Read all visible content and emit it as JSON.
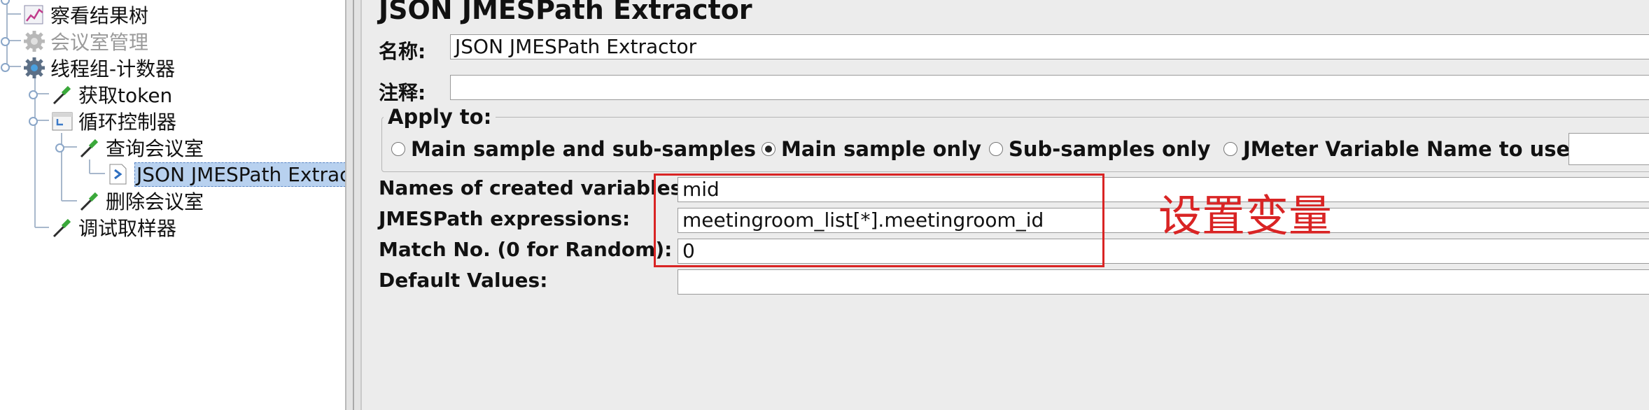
{
  "tree": {
    "items": [
      {
        "label": "察看结果树",
        "icon": "graph-icon"
      },
      {
        "label": "会议室管理",
        "icon": "gear-icon"
      },
      {
        "label": "线程组-计数器",
        "icon": "gear-icon"
      },
      {
        "label": "获取token",
        "icon": "pipette-icon"
      },
      {
        "label": "循环控制器",
        "icon": "loop-controller-icon"
      },
      {
        "label": "查询会议室",
        "icon": "pipette-icon"
      },
      {
        "label": "JSON JMESPath Extrac",
        "icon": "extractor-icon"
      },
      {
        "label": "删除会议室",
        "icon": "pipette-icon"
      },
      {
        "label": "调试取样器",
        "icon": "pipette-icon"
      }
    ]
  },
  "main": {
    "title": "JSON JMESPath Extractor",
    "name_label": "名称:",
    "name_value": "JSON JMESPath Extractor",
    "comment_label": "注释:",
    "comment_value": "",
    "apply_to": {
      "legend": "Apply to:",
      "options": [
        {
          "label": "Main sample and sub-samples",
          "selected": false
        },
        {
          "label": "Main sample only",
          "selected": true
        },
        {
          "label": "Sub-samples only",
          "selected": false
        },
        {
          "label": "JMeter Variable Name to use",
          "selected": false
        }
      ],
      "variable_name_value": ""
    },
    "fields": [
      {
        "label": "Names of created variables:",
        "value": "mid"
      },
      {
        "label": "JMESPath expressions:",
        "value": "meetingroom_list[*].meetingroom_id"
      },
      {
        "label": "Match No. (0 for Random):",
        "value": "0"
      },
      {
        "label": "Default Values:",
        "value": ""
      }
    ],
    "annotation": "设置变量",
    "colors": {
      "annotation": "#d92424",
      "selection": "#b8d1ef"
    }
  }
}
